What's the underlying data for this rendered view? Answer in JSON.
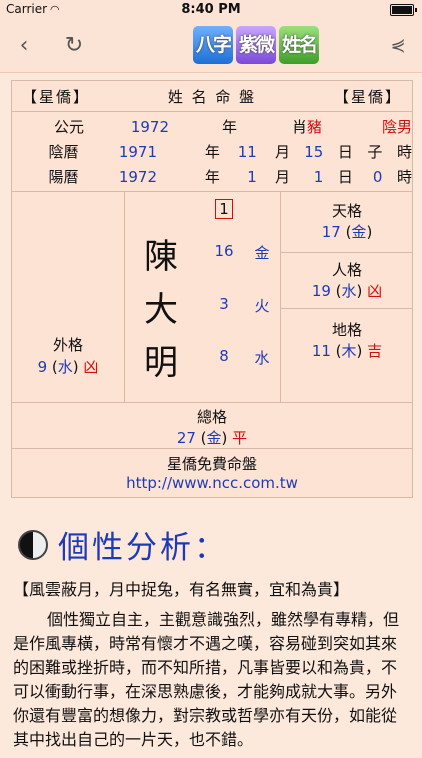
{
  "status": {
    "carrier": "Carrier",
    "time": "8:40 PM"
  },
  "nav": {
    "logo": [
      "八字",
      "紫微",
      "姓名"
    ]
  },
  "chart": {
    "header": {
      "left": "【星僑】",
      "center": "姓 名 命 盤",
      "right": "【星僑】"
    },
    "info": [
      {
        "a": "公元",
        "b": "1972",
        "c": "年",
        "d": "肖",
        "e": "豬",
        "f": "陰男"
      },
      {
        "a": "陰曆",
        "b": "1971",
        "c": "年",
        "d": "11",
        "e": "月",
        "f": "15",
        "g": "日",
        "h": "子",
        "i": "時"
      },
      {
        "a": "陽曆",
        "b": "1972",
        "c": "年",
        "d": "1",
        "e": "月",
        "f": "1",
        "g": "日",
        "h": "0",
        "i": "時"
      }
    ],
    "name_chars": [
      "陳",
      "大",
      "明"
    ],
    "top_number": "1",
    "strokes": [
      "16",
      "3",
      "8"
    ],
    "elements": [
      "金",
      "火",
      "水"
    ],
    "tiange": {
      "label": "天格",
      "num": "17",
      "elem": "金",
      "open": "(",
      "close": ")"
    },
    "renge": {
      "label": "人格",
      "num": "19",
      "elem": "水",
      "luck": "凶"
    },
    "dige": {
      "label": "地格",
      "num": "11",
      "elem": "木",
      "luck": "吉"
    },
    "waige": {
      "label": "外格",
      "num": "9",
      "elem": "水",
      "luck": "凶"
    },
    "zongge": {
      "label": "總格",
      "num": "27",
      "elem": "金",
      "luck": "平"
    },
    "footer": {
      "title": "星僑免費命盤",
      "url": "http://www.ncc.com.tw"
    }
  },
  "section": {
    "title": "個性分析："
  },
  "article": {
    "summary": "【風雲蔽月，月中捉兔，有名無實，宜和為貴】",
    "body": "個性獨立自主，主觀意識強烈，雖然學有專精，但是作風專橫，時常有懷才不遇之嘆，容易碰到突如其來的困難或挫折時，而不知所措，凡事皆要以和為貴，不可以衝動行事，在深思熟慮後，才能夠成就大事。另外你還有豐富的想像力，對宗教或哲學亦有天份，如能從其中找出自己的一片天，也不錯。"
  }
}
